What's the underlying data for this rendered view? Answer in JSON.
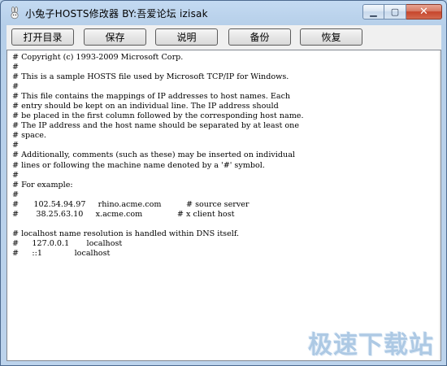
{
  "window": {
    "title": "小兔子HOSTS修改器 BY:吾爱论坛 izisak",
    "app_icon": "rabbit-icon",
    "controls": {
      "minimize_icon": "minimize-icon",
      "maximize_icon": "maximize-icon",
      "close_icon": "close-icon",
      "minimize_glyph": "▁",
      "maximize_glyph": "▢",
      "close_glyph": "✕"
    }
  },
  "toolbar": {
    "buttons": [
      {
        "label": "打开目录"
      },
      {
        "label": "保存"
      },
      {
        "label": "说明"
      },
      {
        "label": "备份"
      },
      {
        "label": "恢复"
      }
    ]
  },
  "editor": {
    "content": "# Copyright (c) 1993-2009 Microsoft Corp.\n#\n# This is a sample HOSTS file used by Microsoft TCP/IP for Windows.\n#\n# This file contains the mappings of IP addresses to host names. Each\n# entry should be kept on an individual line. The IP address should\n# be placed in the first column followed by the corresponding host name.\n# The IP address and the host name should be separated by at least one\n# space.\n#\n# Additionally, comments (such as these) may be inserted on individual\n# lines or following the machine name denoted by a '#' symbol.\n#\n# For example:\n#\n#      102.54.94.97     rhino.acme.com          # source server\n#       38.25.63.10     x.acme.com              # x client host\n\n# localhost name resolution is handled within DNS itself.\n#\t127.0.0.1       localhost\n#\t::1             localhost"
  },
  "watermark": {
    "text": "极速下载站"
  }
}
